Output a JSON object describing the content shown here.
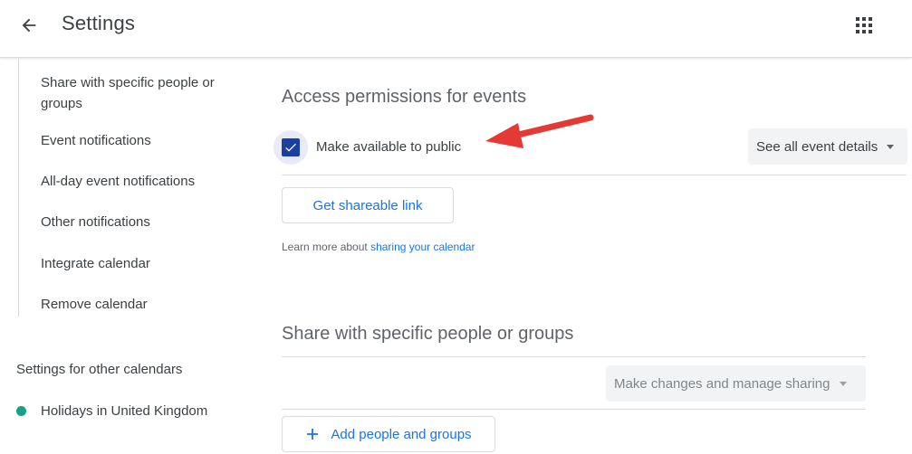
{
  "header": {
    "title": "Settings",
    "back_icon": "arrow-left-icon",
    "apps_icon": "apps-grid-icon"
  },
  "sidebar": {
    "items": [
      {
        "label": "Share with specific people or groups"
      },
      {
        "label": "Event notifications"
      },
      {
        "label": "All-day event notifications"
      },
      {
        "label": "Other notifications"
      },
      {
        "label": "Integrate calendar"
      },
      {
        "label": "Remove calendar"
      }
    ],
    "other_heading": "Settings for other calendars",
    "other_calendars": [
      {
        "label": "Holidays in United Kingdom",
        "color": "#16a085"
      }
    ]
  },
  "access": {
    "title": "Access permissions for events",
    "public_label": "Make available to public",
    "public_checked": true,
    "details_select": "See all event details",
    "share_link_button": "Get shareable link",
    "learn_prefix": "Learn more about",
    "learn_link": "sharing your calendar"
  },
  "sharing": {
    "title": "Share with specific people or groups",
    "permission_select": "Make changes and manage sharing",
    "add_button": "Add people and groups"
  },
  "colors": {
    "accent": "#1a73e8",
    "checkbox": "#1a3fa0",
    "arrow": "#e53935"
  }
}
